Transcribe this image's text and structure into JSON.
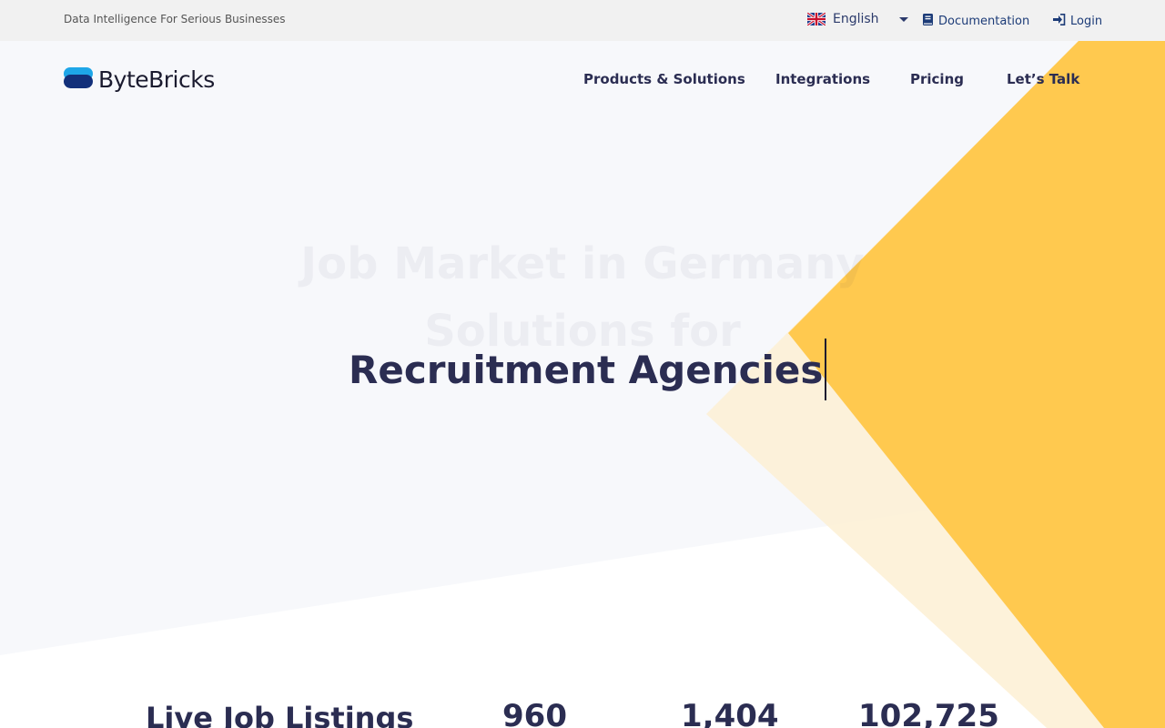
{
  "topbar": {
    "tagline": "Data Intelligence For Serious Businesses",
    "language": "English",
    "documentation": "Documentation",
    "login": "Login"
  },
  "brand": {
    "name": "ByteBricks",
    "primary_color": "#1d3c78",
    "accent_color": "#ffc94f"
  },
  "nav": {
    "items": [
      "Products & Solutions",
      "Integrations",
      "Pricing",
      "Let’s Talk"
    ]
  },
  "hero": {
    "line1_faded": "Job Market in Germany",
    "line2_faded": "Solutions for",
    "typed_text": "Recruitment Agencies"
  },
  "stats": {
    "title": "Live Job Listings",
    "values": [
      "960",
      "1,404",
      "102,725"
    ]
  },
  "icons": {
    "language": "uk-flag-icon",
    "documentation": "book-icon",
    "login": "sign-in-icon"
  }
}
